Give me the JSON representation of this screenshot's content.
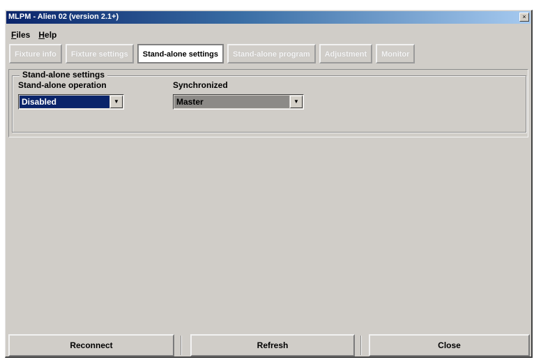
{
  "window": {
    "title": "MLPM - Alien 02 (version 2.1+)",
    "sys_button": "×"
  },
  "menu": [
    {
      "label": "Files",
      "accel": "F"
    },
    {
      "label": "Help",
      "accel": "H"
    }
  ],
  "tabs": [
    {
      "label": "Fixture info",
      "active": false
    },
    {
      "label": "Fixture settings",
      "active": false
    },
    {
      "label": "Stand-alone settings",
      "active": true
    },
    {
      "label": "Stand-alone program",
      "active": false
    },
    {
      "label": "Adjustment",
      "active": false
    },
    {
      "label": "Monitor",
      "active": false
    }
  ],
  "group": {
    "title": "Stand-alone settings",
    "operation": {
      "label": "Stand-alone operation",
      "value": "Disabled"
    },
    "synchronized": {
      "label": "Synchronized",
      "value": "Master"
    }
  },
  "buttons": {
    "reconnect": "Reconnect",
    "refresh": "Refresh",
    "close": "Close"
  },
  "icons": {
    "dropdown": "▼"
  },
  "colors": {
    "selection": "#0a246a",
    "face": "#d0cdc8"
  }
}
